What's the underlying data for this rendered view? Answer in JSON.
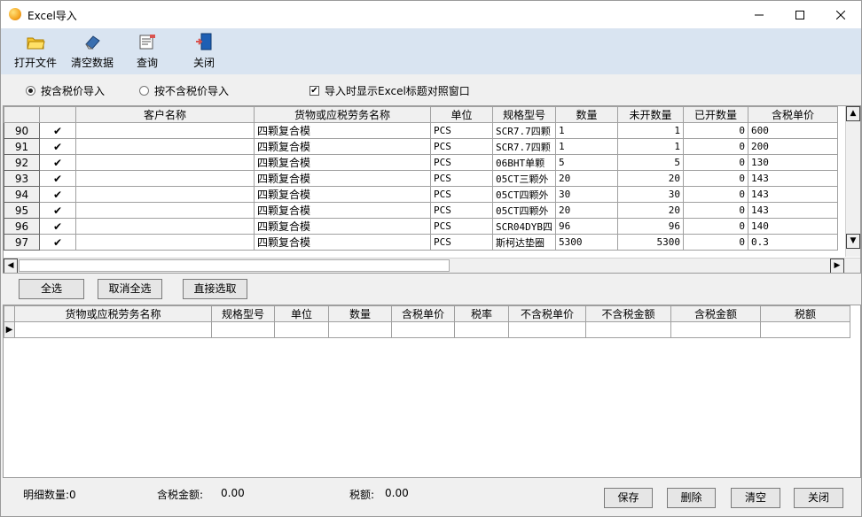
{
  "window": {
    "title": "Excel导入"
  },
  "toolbar": {
    "open_file": "打开文件",
    "clear_data": "清空数据",
    "query": "查询",
    "close": "关闭"
  },
  "options": {
    "radio_tax_incl": "按含税价导入",
    "radio_tax_excl": "按不含税价导入",
    "checkbox_show_title": "导入时显示Excel标题对照窗口",
    "selected": "radio_tax_incl",
    "checkbox_checked": true
  },
  "grid1": {
    "headers": [
      "",
      "",
      "客户名称",
      "货物或应税劳务名称",
      "单位",
      "规格型号",
      "数量",
      "未开数量",
      "已开数量",
      "含税单价"
    ],
    "rows": [
      {
        "no": "90",
        "checked": "✔",
        "customer": "",
        "goods": "四颗复合模",
        "unit": "PCS",
        "spec": "SCR7.7四颗",
        "qty": "1",
        "unopened": "1",
        "opened": "0",
        "price": "600"
      },
      {
        "no": "91",
        "checked": "✔",
        "customer": "",
        "goods": "四颗复合模",
        "unit": "PCS",
        "spec": "SCR7.7四颗",
        "qty": "1",
        "unopened": "1",
        "opened": "0",
        "price": "200"
      },
      {
        "no": "92",
        "checked": "✔",
        "customer": "",
        "goods": "四颗复合模",
        "unit": "PCS",
        "spec": "06BHT单颗",
        "qty": "5",
        "unopened": "5",
        "opened": "0",
        "price": "130"
      },
      {
        "no": "93",
        "checked": "✔",
        "customer": "",
        "goods": "四颗复合模",
        "unit": "PCS",
        "spec": "05CT三颗外",
        "qty": "20",
        "unopened": "20",
        "opened": "0",
        "price": "143"
      },
      {
        "no": "94",
        "checked": "✔",
        "customer": "",
        "goods": "四颗复合模",
        "unit": "PCS",
        "spec": "05CT四颗外",
        "qty": "30",
        "unopened": "30",
        "opened": "0",
        "price": "143"
      },
      {
        "no": "95",
        "checked": "✔",
        "customer": "",
        "goods": "四颗复合模",
        "unit": "PCS",
        "spec": "05CT四颗外",
        "qty": "20",
        "unopened": "20",
        "opened": "0",
        "price": "143"
      },
      {
        "no": "96",
        "checked": "✔",
        "customer": "",
        "goods": "四颗复合模",
        "unit": "PCS",
        "spec": "SCR04DYB四",
        "qty": "96",
        "unopened": "96",
        "opened": "0",
        "price": "140"
      },
      {
        "no": "97",
        "checked": "✔",
        "customer": "",
        "goods": "四颗复合模",
        "unit": "PCS",
        "spec": "斯柯达垫圈",
        "qty": "5300",
        "unopened": "5300",
        "opened": "0",
        "price": "0.3"
      }
    ]
  },
  "select_buttons": {
    "select_all": "全选",
    "deselect_all": "取消全选",
    "direct_select": "直接选取"
  },
  "grid2": {
    "headers": [
      "",
      "货物或应税劳务名称",
      "规格型号",
      "单位",
      "数量",
      "含税单价",
      "税率",
      "不含税单价",
      "不含税金额",
      "含税金额",
      "税额"
    ],
    "row_marker": "▶"
  },
  "footer": {
    "detail_count": "明细数量:0",
    "tax_incl_amount_label": "含税金额:",
    "tax_incl_amount_value": "0.00",
    "tax_label": "税额:",
    "tax_value": "0.00",
    "save": "保存",
    "delete": "删除",
    "clear": "清空",
    "close": "关闭"
  }
}
